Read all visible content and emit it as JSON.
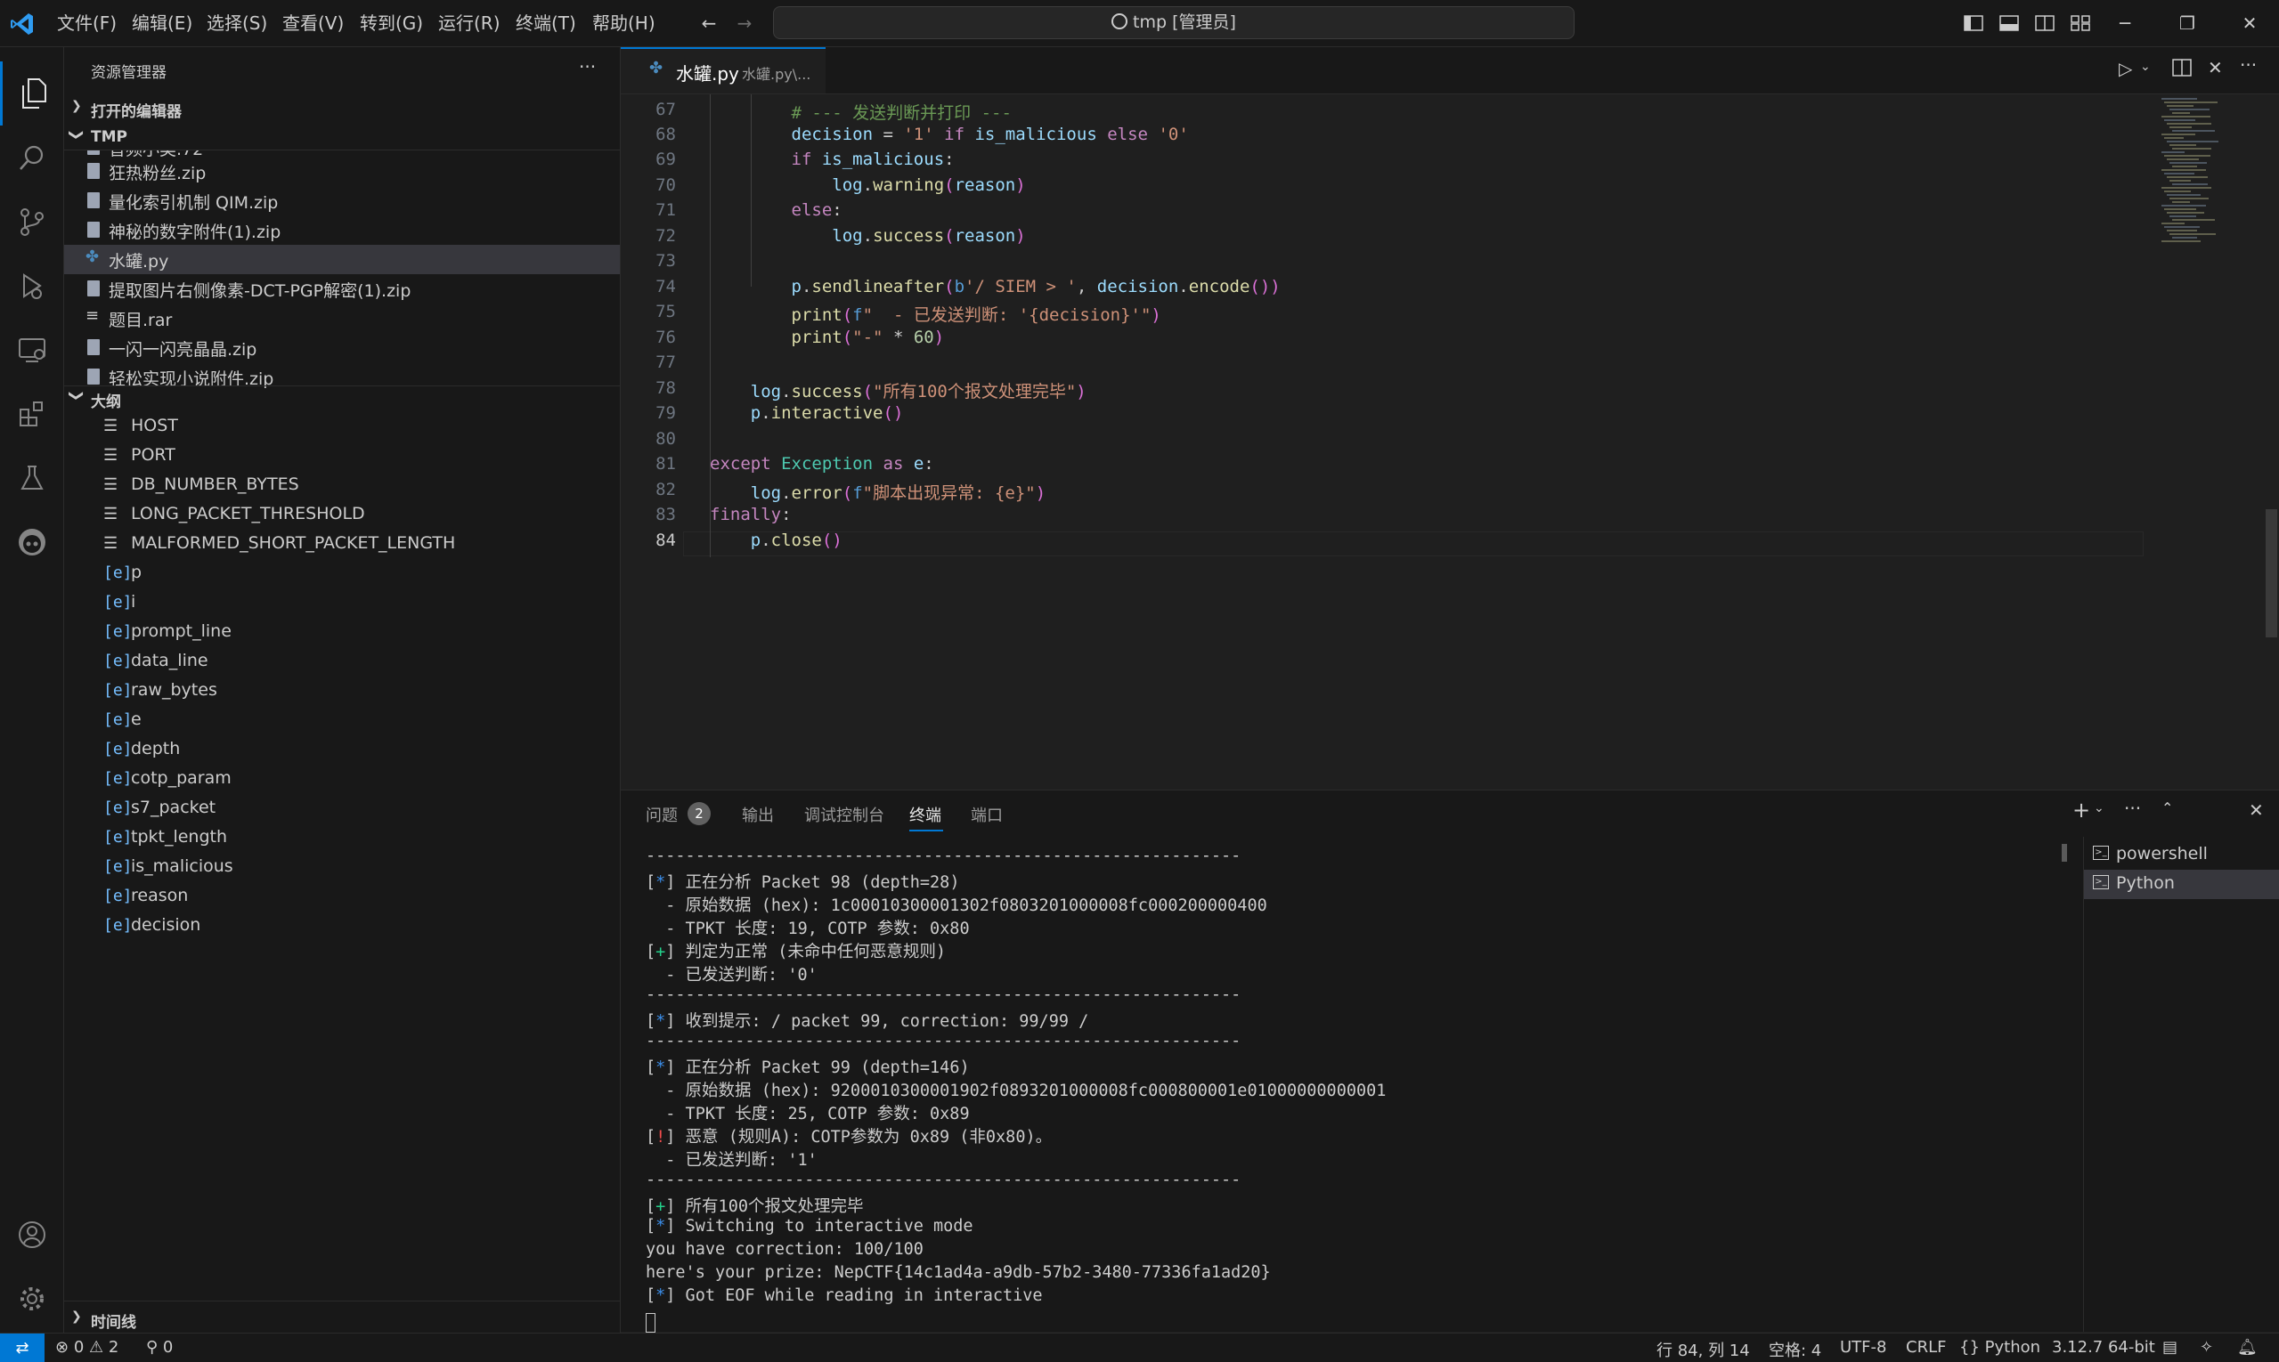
{
  "menu": [
    "文件(F)",
    "编辑(E)",
    "选择(S)",
    "查看(V)",
    "转到(G)",
    "运行(R)",
    "终端(T)",
    "帮助(H)"
  ],
  "search": {
    "label": "tmp [管理员]"
  },
  "explorer": {
    "title": "资源管理器",
    "open_editors": "打开的编辑器",
    "folder": "TMP",
    "partial_top": "音频小类.72",
    "files": [
      "狂热粉丝.zip",
      "量化索引机制 QIM.zip",
      "神秘的数字附件(1).zip",
      "水罐.py",
      "提取图片右侧像素-DCT-PGP解密(1).zip",
      "题目.rar",
      "一闪一闪亮晶晶.zip"
    ],
    "partial_bottom": "轻松实现小说附件.zip",
    "outline_title": "大纲",
    "outline": [
      {
        "name": "HOST",
        "kind": "const"
      },
      {
        "name": "PORT",
        "kind": "const"
      },
      {
        "name": "DB_NUMBER_BYTES",
        "kind": "const"
      },
      {
        "name": "LONG_PACKET_THRESHOLD",
        "kind": "const"
      },
      {
        "name": "MALFORMED_SHORT_PACKET_LENGTH",
        "kind": "const"
      },
      {
        "name": "p",
        "kind": "var"
      },
      {
        "name": "i",
        "kind": "var"
      },
      {
        "name": "prompt_line",
        "kind": "var"
      },
      {
        "name": "data_line",
        "kind": "var"
      },
      {
        "name": "raw_bytes",
        "kind": "var"
      },
      {
        "name": "e",
        "kind": "var"
      },
      {
        "name": "depth",
        "kind": "var"
      },
      {
        "name": "cotp_param",
        "kind": "var"
      },
      {
        "name": "s7_packet",
        "kind": "var"
      },
      {
        "name": "tpkt_length",
        "kind": "var"
      },
      {
        "name": "is_malicious",
        "kind": "var"
      },
      {
        "name": "reason",
        "kind": "var"
      },
      {
        "name": "decision",
        "kind": "var"
      }
    ],
    "timeline": "时间线"
  },
  "tab": {
    "name": "水罐.py",
    "path": "水罐.py\\..."
  },
  "editor": {
    "line_numbers": [
      "67",
      "68",
      "69",
      "70",
      "71",
      "72",
      "73",
      "74",
      "75",
      "76",
      "77",
      "78",
      "79",
      "80",
      "81",
      "82",
      "83",
      "84"
    ],
    "lines": [
      "        # --- 发送判断并打印 ---",
      "        decision = '1' if is_malicious else '0'",
      "        if is_malicious:",
      "            log.warning(reason)",
      "        else:",
      "            log.success(reason)",
      "",
      "        p.sendlineafter(b'/ SIEM > ', decision.encode())",
      "        print(f\"  - 已发送判断: '{decision}'\")",
      "        print(\"-\" * 60)",
      "",
      "    log.success(\"所有100个报文处理完毕\")",
      "    p.interactive()",
      "",
      "except Exception as e:",
      "    log.error(f\"脚本出现异常: {e}\")",
      "finally:",
      "    p.close()"
    ]
  },
  "panel": {
    "tabs": [
      "问题",
      "输出",
      "调试控制台",
      "终端",
      "端口"
    ],
    "problems_count": "2",
    "terminals": [
      "powershell",
      "Python"
    ],
    "terminal_lines": [
      "------------------------------------------------------------",
      "[*] 正在分析 Packet 98 (depth=28)",
      "  - 原始数据 (hex): 1c00010300001302f0803201000008fc000200000400",
      "  - TPKT 长度: 19, COTP 参数: 0x80",
      "[+] 判定为正常 (未命中任何恶意规则)",
      "  - 已发送判断: '0'",
      "------------------------------------------------------------",
      "[*] 收到提示: / packet 99, correction: 99/99 /",
      "------------------------------------------------------------",
      "[*] 正在分析 Packet 99 (depth=146)",
      "  - 原始数据 (hex): 9200010300001902f0893201000008fc000800001e01000000000001",
      "  - TPKT 长度: 25, COTP 参数: 0x89",
      "[!] 恶意 (规则A): COTP参数为 0x89 (非0x80)。",
      "  - 已发送判断: '1'",
      "------------------------------------------------------------",
      "[+] 所有100个报文处理完毕",
      "[*] Switching to interactive mode",
      "you have correction: 100/100",
      "here's your prize: NepCTF{14c1ad4a-a9db-57b2-3480-77336fa1ad20}",
      "[*] Got EOF while reading in interactive"
    ]
  },
  "status": {
    "errors": "0",
    "warnings": "2",
    "ports": "0",
    "position": "行 84, 列 14",
    "spaces": "空格: 4",
    "encoding": "UTF-8",
    "eol": "CRLF",
    "language": "Python",
    "interpreter": "3.12.7 64-bit"
  }
}
